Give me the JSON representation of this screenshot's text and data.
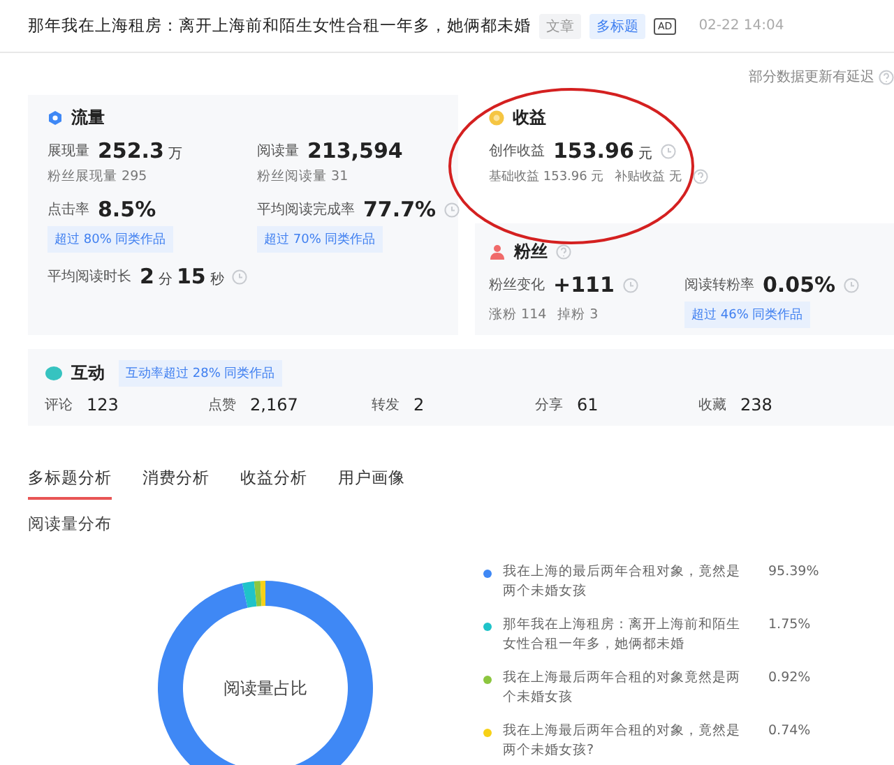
{
  "article": {
    "title": "那年我在上海租房：离开上海前和陌生女性合租一年多，她俩都未婚",
    "tags": [
      {
        "label": "文章",
        "kind": "plain"
      },
      {
        "label": "多标题",
        "kind": "accent"
      }
    ],
    "ad_badge": "AD",
    "time": "02-22 14:04"
  },
  "notice": "部分数据更新有延迟",
  "traffic": {
    "title": "流量",
    "metrics": [
      {
        "label": "展现量",
        "value": [
          {
            "kind": "num",
            "text": "252.3"
          },
          {
            "kind": "unit",
            "text": "万"
          }
        ],
        "sub": "粉丝展现量 295",
        "trend_icon": false
      },
      {
        "label": "阅读量",
        "value": [
          {
            "kind": "num",
            "text": "213,594"
          }
        ],
        "sub": "粉丝阅读量 31",
        "trend_icon": false
      },
      {
        "label": "点击率",
        "value": [
          {
            "kind": "num",
            "text": "8.5%"
          }
        ],
        "badge": "超过 80% 同类作品",
        "trend_icon": false
      },
      {
        "label": "平均阅读完成率",
        "value": [
          {
            "kind": "num",
            "text": "77.7%"
          }
        ],
        "badge": "超过 70% 同类作品",
        "trend_icon": true
      },
      {
        "label": "平均阅读时长",
        "value": [
          {
            "kind": "num",
            "text": "2"
          },
          {
            "kind": "unit",
            "text": "分"
          },
          {
            "kind": "num",
            "text": "15"
          },
          {
            "kind": "unit",
            "text": "秒"
          }
        ],
        "trend_icon": true
      }
    ]
  },
  "income": {
    "title": "收益",
    "metric": {
      "label": "创作收益",
      "value": [
        {
          "kind": "num",
          "text": "153.96"
        },
        {
          "kind": "unit",
          "text": "元"
        }
      ],
      "trend_icon": true
    },
    "details": [
      "基础收益 153.96 元",
      "补贴收益  无"
    ]
  },
  "fans": {
    "title": "粉丝",
    "metrics": [
      {
        "label": "粉丝变化",
        "value": [
          {
            "kind": "num",
            "text": "+111"
          }
        ],
        "subs": [
          "涨粉 114",
          "掉粉 3"
        ],
        "trend_icon": true
      },
      {
        "label": "阅读转粉率",
        "value": [
          {
            "kind": "num",
            "text": "0.05%"
          }
        ],
        "badge": "超过 46% 同类作品",
        "trend_icon": true
      }
    ]
  },
  "interaction": {
    "title": "互动",
    "badge": "互动率超过 28% 同类作品",
    "stats": [
      {
        "label": "评论",
        "value": "123"
      },
      {
        "label": "点赞",
        "value": "2,167"
      },
      {
        "label": "转发",
        "value": "2"
      },
      {
        "label": "分享",
        "value": "61"
      },
      {
        "label": "收藏",
        "value": "238"
      }
    ]
  },
  "tabs": [
    {
      "label": "多标题分析",
      "selected": true
    },
    {
      "label": "消费分析",
      "selected": false
    },
    {
      "label": "收益分析",
      "selected": false
    },
    {
      "label": "用户画像",
      "selected": false
    }
  ],
  "section_title": "阅读量分布",
  "chart_data": {
    "type": "donut",
    "title": "阅读量占比",
    "values": [
      95.39,
      1.75,
      0.92,
      0.74
    ]
  },
  "legend": [
    {
      "label": "我在上海的最后两年合租对象，竟然是两个未婚女孩",
      "percent": "95.39%",
      "color": "#3f88f5"
    },
    {
      "label": "那年我在上海租房：离开上海前和陌生女性合租一年多，她俩都未婚",
      "percent": "1.75%",
      "color": "#1fc3c9"
    },
    {
      "label": "我在上海最后两年合租的对象竟然是两个未婚女孩",
      "percent": "0.92%",
      "color": "#8cc63f"
    },
    {
      "label": "我在上海最后两年合租的对象，竟然是两个未婚女孩?",
      "percent": "0.74%",
      "color": "#f7d117"
    }
  ],
  "annotations": [
    {
      "kind": "ellipse"
    }
  ]
}
